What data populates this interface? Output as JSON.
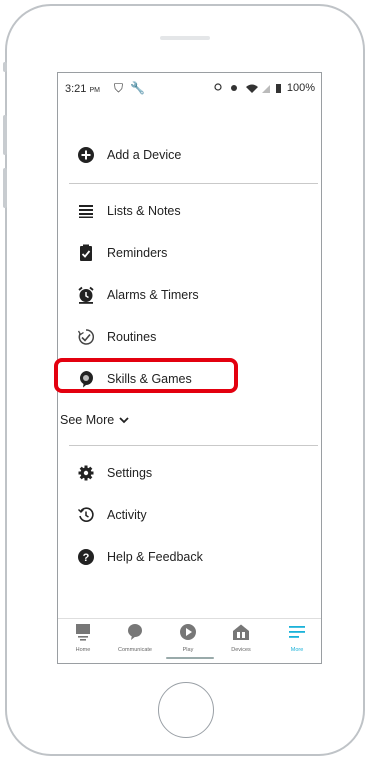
{
  "status_bar": {
    "time": "3:21",
    "ampm": "PM",
    "battery": "100%"
  },
  "menu": {
    "add_device": "Add a Device",
    "lists_notes": "Lists & Notes",
    "reminders": "Reminders",
    "alarms_timers": "Alarms & Timers",
    "routines": "Routines",
    "skills_games": "Skills & Games",
    "see_more": "See More",
    "settings": "Settings",
    "activity": "Activity",
    "help_feedback": "Help & Feedback"
  },
  "tabs": [
    {
      "label": "Home",
      "icon": "home-icon"
    },
    {
      "label": "Communicate",
      "icon": "chat-bubble-icon"
    },
    {
      "label": "Play",
      "icon": "play-icon"
    },
    {
      "label": "Devices",
      "icon": "devices-icon"
    },
    {
      "label": "More",
      "icon": "hamburger-icon"
    }
  ],
  "colors": {
    "accent": "#1bb2d9",
    "highlight": "#e3000f",
    "icon": "#222222"
  }
}
